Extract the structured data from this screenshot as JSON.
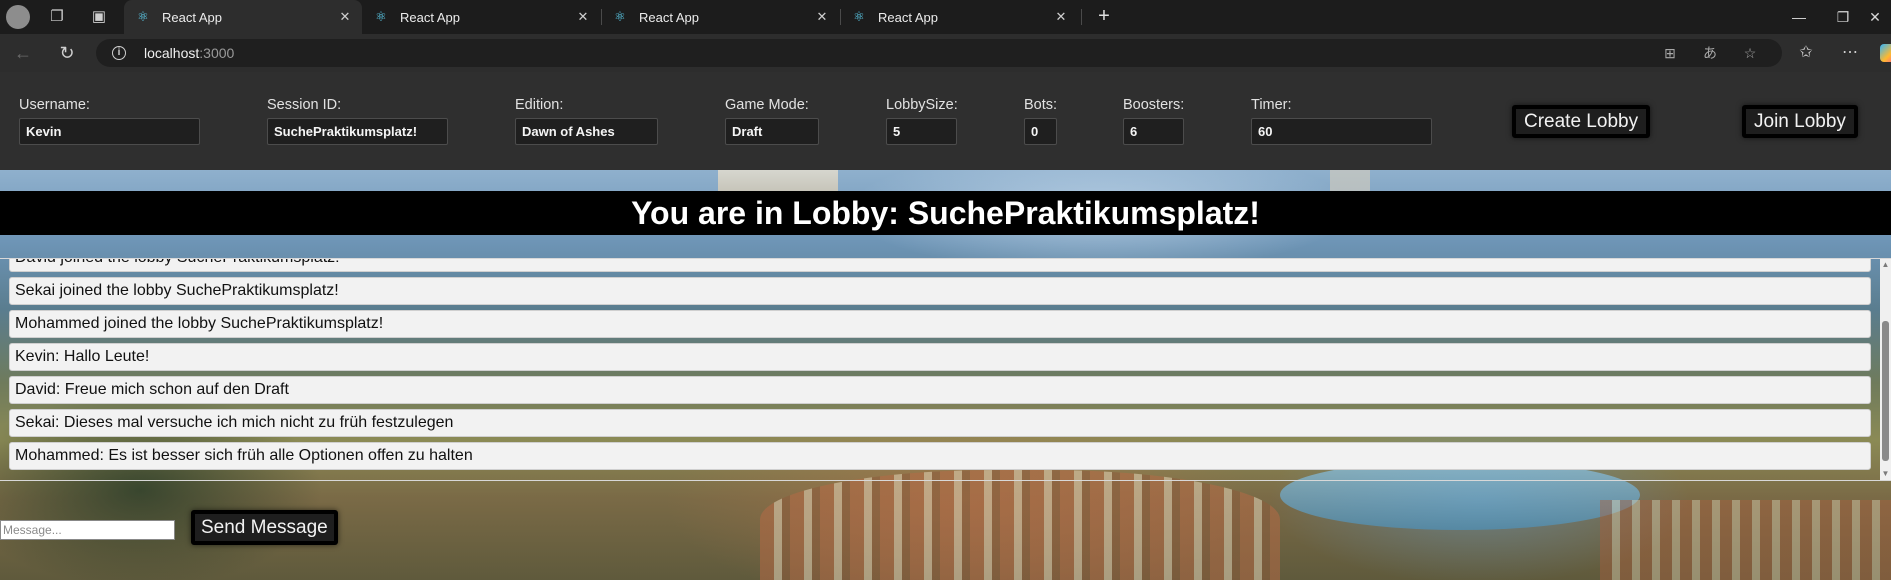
{
  "browser": {
    "tabs": [
      {
        "title": "React App",
        "active": true
      },
      {
        "title": "React App",
        "active": false
      },
      {
        "title": "React App",
        "active": false
      },
      {
        "title": "React App",
        "active": false
      }
    ],
    "address": {
      "host": "localhost",
      "port": ":3000"
    }
  },
  "header": {
    "username": {
      "label": "Username:",
      "value": "Kevin"
    },
    "session_id": {
      "label": "Session ID:",
      "value": "SuchePraktikumsplatz!"
    },
    "edition": {
      "label": "Edition:",
      "value": "Dawn of Ashes"
    },
    "game_mode": {
      "label": "Game Mode:",
      "value": "Draft"
    },
    "lobby_size": {
      "label": "LobbySize:",
      "value": "5"
    },
    "bots": {
      "label": "Bots:",
      "value": "0"
    },
    "boosters": {
      "label": "Boosters:",
      "value": "6"
    },
    "timer": {
      "label": "Timer:",
      "value": "60"
    },
    "create_lobby_label": "Create Lobby",
    "join_lobby_label": "Join Lobby"
  },
  "lobby": {
    "banner": "You are in Lobby: SuchePraktikumsplatz!"
  },
  "chat": {
    "messages": [
      "David joined the lobby SuchePraktikumsplatz!",
      "Sekai joined the lobby SuchePraktikumsplatz!",
      "Mohammed joined the lobby SuchePraktikumsplatz!",
      "Kevin: Hallo Leute!",
      "David: Freue mich schon auf den Draft",
      "Sekai: Dieses mal versuche ich mich nicht zu früh festzulegen",
      "Mohammed: Es ist besser sich früh alle Optionen offen zu halten"
    ],
    "input_placeholder": "Message...",
    "send_label": "Send Message"
  }
}
